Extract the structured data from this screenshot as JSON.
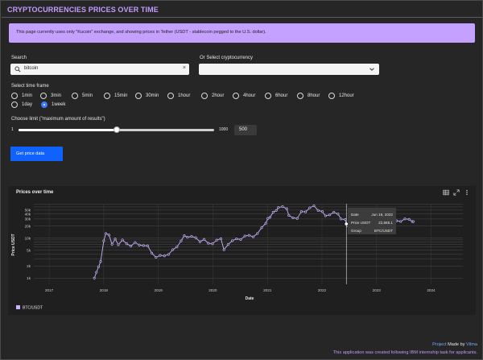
{
  "app": {
    "title": "CRYPTOCURRENCIES PRICES OVER TIME",
    "notice": "This page currently uses only \"Kucoin\" exchange, and showing prices in Tether (USDT - stablecoin pegged to the U.S. dollar)."
  },
  "search": {
    "label": "Search",
    "value": "bitcoin",
    "clear": "×",
    "icon": "search-icon"
  },
  "crypto_select": {
    "label": "Or Select cryptocurrency",
    "value": "",
    "icon": "chevron-down-icon"
  },
  "timeframe": {
    "label": "Select time frame",
    "options": [
      "1min",
      "3min",
      "5min",
      "15min",
      "30min",
      "1hour",
      "2hour",
      "4hour",
      "6hour",
      "8hour",
      "12hour",
      "1day",
      "1week"
    ],
    "selected": "1week"
  },
  "limit": {
    "label": "Choose limit (\"maximum amount of results\")",
    "min": "1",
    "max": "1000",
    "value": "500",
    "fraction": 0.5
  },
  "button": {
    "label": "Get price data"
  },
  "chart": {
    "title": "Prices over time",
    "toolbar_icons": [
      "table-icon",
      "expand-icon",
      "more-vert-icon"
    ]
  },
  "chart_data": {
    "type": "line",
    "title": "Prices over time",
    "xlabel": "Date",
    "ylabel": "Price USDT",
    "yscale": "log",
    "y_tick_labels": [
      "1k",
      "2k",
      "5k",
      "10k",
      "20k",
      "30k",
      "40k",
      "50k"
    ],
    "x_tick_labels": [
      "2017",
      "2018",
      "2019",
      "2020",
      "2021",
      "2022",
      "2023",
      "2024"
    ],
    "grid": true,
    "legend_position": "bottom-left",
    "series": [
      {
        "name": "BTC/USDT",
        "color": "#c9b3ff",
        "points": [
          [
            "2017-10-30",
            1000
          ],
          [
            "2017-11-13",
            1400
          ],
          [
            "2017-11-27",
            1900
          ],
          [
            "2017-12-11",
            2600
          ],
          [
            "2018-01-01",
            8500
          ],
          [
            "2018-01-15",
            13000
          ],
          [
            "2018-02-05",
            12000
          ],
          [
            "2018-02-26",
            7000
          ],
          [
            "2018-03-19",
            9500
          ],
          [
            "2018-04-09",
            6800
          ],
          [
            "2018-05-07",
            9000
          ],
          [
            "2018-06-04",
            7200
          ],
          [
            "2018-07-02",
            6300
          ],
          [
            "2018-07-30",
            7800
          ],
          [
            "2018-08-27",
            6700
          ],
          [
            "2018-09-24",
            6500
          ],
          [
            "2018-10-22",
            6400
          ],
          [
            "2018-11-19",
            4200
          ],
          [
            "2018-12-17",
            3300
          ],
          [
            "2019-01-14",
            3700
          ],
          [
            "2019-02-11",
            3600
          ],
          [
            "2019-03-11",
            3900
          ],
          [
            "2019-04-08",
            5100
          ],
          [
            "2019-05-06",
            6000
          ],
          [
            "2019-06-03",
            8500
          ],
          [
            "2019-06-24",
            11500
          ],
          [
            "2019-07-15",
            10500
          ],
          [
            "2019-08-12",
            11000
          ],
          [
            "2019-09-09",
            10200
          ],
          [
            "2019-10-07",
            8100
          ],
          [
            "2019-11-04",
            9300
          ],
          [
            "2019-12-02",
            7400
          ],
          [
            "2019-12-30",
            7200
          ],
          [
            "2020-01-27",
            8900
          ],
          [
            "2020-02-24",
            9700
          ],
          [
            "2020-03-16",
            5100
          ],
          [
            "2020-04-13",
            6900
          ],
          [
            "2020-05-11",
            8600
          ],
          [
            "2020-06-08",
            9600
          ],
          [
            "2020-07-06",
            9200
          ],
          [
            "2020-08-03",
            11300
          ],
          [
            "2020-08-31",
            11700
          ],
          [
            "2020-09-28",
            10700
          ],
          [
            "2020-10-26",
            13000
          ],
          [
            "2020-11-23",
            18200
          ],
          [
            "2020-12-21",
            23500
          ],
          [
            "2021-01-04",
            31000
          ],
          [
            "2021-01-18",
            33000
          ],
          [
            "2021-02-08",
            44000
          ],
          [
            "2021-03-01",
            49000
          ],
          [
            "2021-03-15",
            58000
          ],
          [
            "2021-04-12",
            61000
          ],
          [
            "2021-05-10",
            54000
          ],
          [
            "2021-05-24",
            37000
          ],
          [
            "2021-06-21",
            32000
          ],
          [
            "2021-07-19",
            31000
          ],
          [
            "2021-08-16",
            46000
          ],
          [
            "2021-09-13",
            45000
          ],
          [
            "2021-10-11",
            57000
          ],
          [
            "2021-11-08",
            64000
          ],
          [
            "2021-12-06",
            49000
          ],
          [
            "2022-01-03",
            46000
          ],
          [
            "2022-01-24",
            36000
          ],
          [
            "2022-02-21",
            38000
          ],
          [
            "2022-03-21",
            44000
          ],
          [
            "2022-04-18",
            40000
          ],
          [
            "2022-05-09",
            30000
          ],
          [
            "2022-06-06",
            29000
          ],
          [
            "2022-06-13",
            22600
          ],
          [
            "2022-06-20",
            20500
          ],
          [
            "2022-07-18",
            21500
          ],
          [
            "2022-08-15",
            23500
          ],
          [
            "2022-09-12",
            19500
          ],
          [
            "2022-10-10",
            19200
          ],
          [
            "2022-11-07",
            16500
          ],
          [
            "2022-12-05",
            17000
          ],
          [
            "2023-01-02",
            16600
          ],
          [
            "2023-01-30",
            23000
          ],
          [
            "2023-02-27",
            22000
          ],
          [
            "2023-03-20",
            28000
          ],
          [
            "2023-04-17",
            29500
          ],
          [
            "2023-05-15",
            27000
          ],
          [
            "2023-06-12",
            26000
          ],
          [
            "2023-07-10",
            30200
          ],
          [
            "2023-08-07",
            29400
          ],
          [
            "2023-08-28",
            26000
          ],
          [
            "2023-09-04",
            25800
          ]
        ]
      }
    ],
    "tooltip": {
      "date_label": "Date",
      "date_value": "Jun 19, 2022",
      "price_label": "Price USDT",
      "price_value": "22,565.1",
      "group_label": "Group",
      "group_value": "BTC/USDT"
    }
  },
  "footer": {
    "project_link": "Project",
    "made_by": "Made by",
    "author": "Vilma",
    "note": "This application was created following IBM internship task for applicants."
  }
}
